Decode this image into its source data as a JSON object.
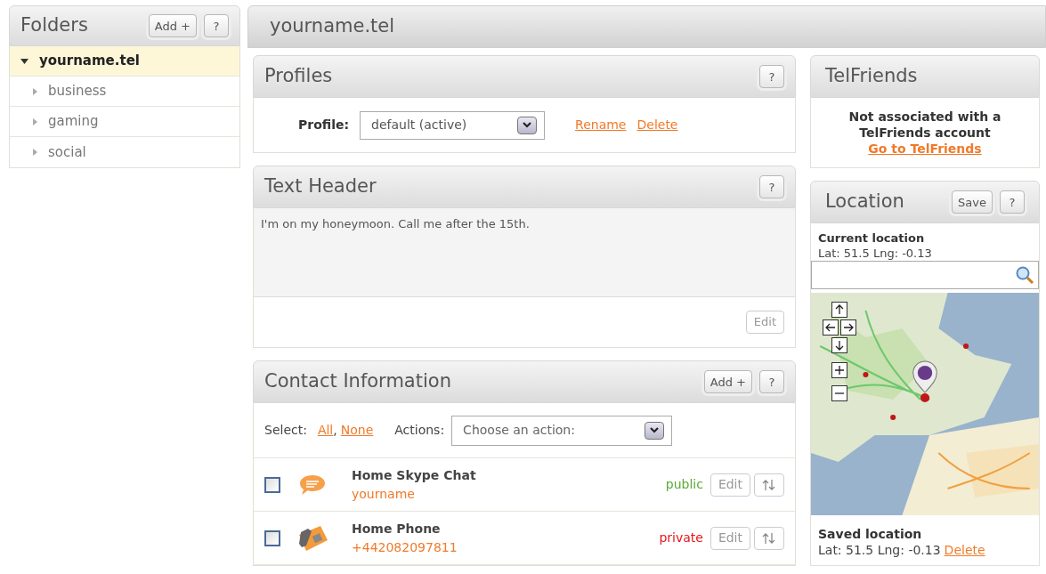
{
  "folders": {
    "title": "Folders",
    "add_button": "Add +",
    "help_button": "?",
    "items": [
      {
        "label": "yourname.tel",
        "selected": true,
        "expanded": true
      },
      {
        "label": "business",
        "selected": false,
        "expanded": false
      },
      {
        "label": "gaming",
        "selected": false,
        "expanded": false
      },
      {
        "label": "social",
        "selected": false,
        "expanded": false
      }
    ]
  },
  "page_title": "yourname.tel",
  "profiles": {
    "title": "Profiles",
    "help_button": "?",
    "label": "Profile:",
    "value": "default (active)",
    "links": [
      "Rename",
      "Delete"
    ]
  },
  "text_header": {
    "title": "Text Header",
    "help_button": "?",
    "value": "I'm on my honeymoon. Call me after the 15th.",
    "edit_button": "Edit"
  },
  "contact_information": {
    "title": "Contact Information",
    "add_button": "Add +",
    "help_button": "?",
    "select_label": "Select:",
    "select_all": "All",
    "separator": ",",
    "select_none": "None",
    "actions_label": "Actions:",
    "actions_value": "Choose an action:",
    "rows": [
      {
        "kind": "chat",
        "name": "Home Skype Chat",
        "value": "yourname",
        "visibility": "public",
        "color": "#5aa832",
        "checked": false,
        "edit_button": "Edit"
      },
      {
        "kind": "phone",
        "name": "Home Phone",
        "value": "+442082097811",
        "visibility": "private",
        "color": "#e8141b",
        "checked": false,
        "edit_button": "Edit"
      }
    ]
  },
  "telfriends": {
    "title": "TelFriends",
    "message": "Not associated with a TelFriends account",
    "link": "Go to TelFriends"
  },
  "location": {
    "title": "Location",
    "save_button": "Save",
    "help_button": "?",
    "current_heading": "Current location",
    "current_coords": "Lat: 51.5 Lng: -0.13",
    "saved_heading": "Saved location",
    "saved_coords": "Lat: 51.5 Lng: -0.13",
    "delete_link": "Delete"
  }
}
